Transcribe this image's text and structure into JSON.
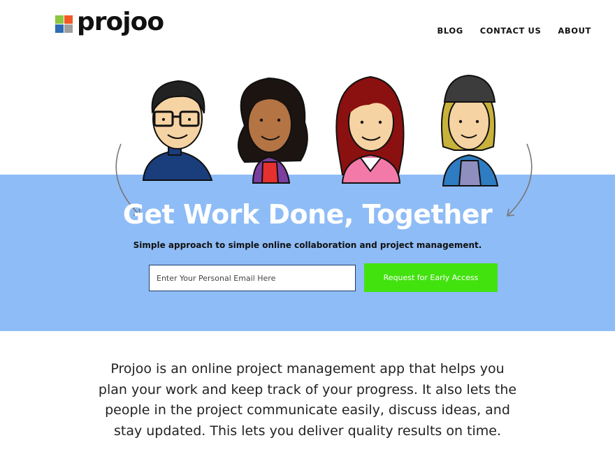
{
  "brand": {
    "name": "projoo",
    "logo_colors": [
      "#f15a24",
      "#8dc63f",
      "#2e6db4",
      "#9e9e9e"
    ]
  },
  "nav": {
    "items": [
      "BLOG",
      "CONTACT US",
      "ABOUT"
    ]
  },
  "hero": {
    "title": "Get Work Done, Together",
    "subtitle": "Simple approach to simple online collaboration and project management.",
    "email_placeholder": "Enter Your Personal Email Here",
    "cta_label": "Request for Early Access",
    "band_color": "#8ebcf6",
    "cta_color": "#42e20f"
  },
  "about": {
    "text": "Projoo is an online project management app that helps you plan your work and keep track of your progress. It also lets the people in the project communicate easily, discuss ideas, and stay updated. This lets you deliver quality results on time."
  }
}
